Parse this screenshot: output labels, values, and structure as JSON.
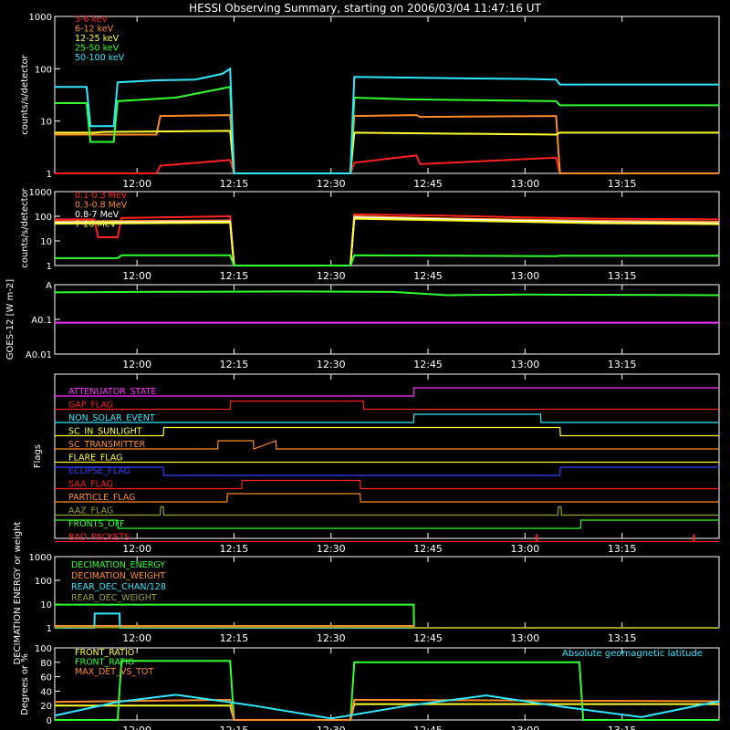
{
  "title": "HESSI Observing Summary, starting on 2006/03/04 11:47:16 UT",
  "time_ticks": [
    "12:00",
    "12:15",
    "12:30",
    "12:45",
    "13:00",
    "13:15"
  ],
  "colors": {
    "red": "#ff2020",
    "orange": "#ff8c28",
    "yellow": "#ffff30",
    "green": "#30ff30",
    "cyan": "#30e8ff",
    "magenta": "#ff30ff",
    "blue": "#3040ff",
    "olive": "#9aa020",
    "white": "#ffffff"
  },
  "chart_data": [
    {
      "id": "lightcurve_low",
      "type": "line",
      "ylabel": "counts/s/detector",
      "yscale": "log",
      "ylim": [
        1,
        1000
      ],
      "yticks": [
        "1",
        "10",
        "100",
        "1000"
      ],
      "series": [
        {
          "name": "3-6 keV",
          "color": "red",
          "x": [
            11.788,
            12.05,
            12.06,
            12.24,
            12.25,
            12.55,
            12.56,
            12.72,
            12.73,
            13.08,
            13.09,
            13.5
          ],
          "y": [
            1,
            1,
            1.4,
            1.8,
            1,
            1,
            1.6,
            2.2,
            1.5,
            2.0,
            1,
            1
          ]
        },
        {
          "name": "6-12 keV",
          "color": "orange",
          "x": [
            11.788,
            12.05,
            12.06,
            12.24,
            12.25,
            12.55,
            12.56,
            12.72,
            12.73,
            13.08,
            13.09,
            13.5
          ],
          "y": [
            5.5,
            5.5,
            12.5,
            13,
            1,
            1,
            12.5,
            13,
            12,
            12.5,
            1,
            1
          ]
        },
        {
          "name": "12-25 keV",
          "color": "yellow",
          "x": [
            11.788,
            11.89,
            11.91,
            12.24,
            12.25,
            12.55,
            12.56,
            13.08,
            13.09,
            13.5
          ],
          "y": [
            6,
            6,
            6.2,
            6.5,
            1,
            1,
            6,
            5.5,
            6,
            6
          ]
        },
        {
          "name": "25-50 keV",
          "color": "green",
          "x": [
            11.788,
            11.87,
            11.88,
            11.94,
            11.95,
            12.1,
            12.24,
            12.25,
            12.55,
            12.56,
            12.7,
            12.9,
            13.08,
            13.09,
            13.5
          ],
          "y": [
            22,
            22,
            4,
            4,
            24,
            28,
            45,
            1,
            1,
            28,
            26,
            25,
            24,
            20,
            20
          ]
        },
        {
          "name": "50-100 keV",
          "color": "cyan",
          "x": [
            11.788,
            11.87,
            11.88,
            11.94,
            11.95,
            12.05,
            12.15,
            12.22,
            12.24,
            12.25,
            12.55,
            12.56,
            12.8,
            13.0,
            13.08,
            13.09,
            13.5
          ],
          "y": [
            45,
            45,
            8,
            8,
            55,
            60,
            62,
            80,
            100,
            1,
            1,
            70,
            66,
            64,
            62,
            50,
            50
          ]
        }
      ]
    },
    {
      "id": "lightcurve_high",
      "type": "line",
      "ylabel": "counts/s/detector",
      "yscale": "log",
      "ylim": [
        1,
        1000
      ],
      "yticks": [
        "1",
        "10",
        "100",
        "1000"
      ],
      "series": [
        {
          "name": "0.1-0.3 MeV",
          "color": "red",
          "x": [
            11.788,
            11.89,
            11.9,
            11.95,
            11.96,
            12.24,
            12.25,
            12.55,
            12.56,
            12.8,
            13.0,
            13.2,
            13.5
          ],
          "y": [
            75,
            75,
            14,
            14,
            85,
            100,
            1,
            1,
            120,
            105,
            90,
            80,
            75
          ]
        },
        {
          "name": "0.3-0.8 MeV",
          "color": "orange",
          "x": [
            11.788,
            12.24,
            12.25,
            12.55,
            12.56,
            12.8,
            13.2,
            13.5
          ],
          "y": [
            62,
            68,
            1,
            1,
            100,
            82,
            65,
            60
          ]
        },
        {
          "name": "0.8-7 MeV",
          "color": "white",
          "x": [
            11.788,
            12.24,
            12.25,
            12.55,
            12.56,
            12.8,
            13.2,
            13.5
          ],
          "y": [
            55,
            60,
            1,
            1,
            90,
            75,
            58,
            52
          ]
        },
        {
          "name": "7-20 MeV",
          "color": "yellow",
          "x": [
            11.788,
            12.24,
            12.25,
            12.55,
            12.56,
            12.8,
            13.2,
            13.5
          ],
          "y": [
            50,
            55,
            1,
            1,
            80,
            68,
            52,
            48
          ]
        },
        {
          "name": "",
          "color": "green",
          "x": [
            11.788,
            11.95,
            11.96,
            12.24,
            12.25,
            12.55,
            12.56,
            13.08,
            13.09,
            13.5
          ],
          "y": [
            2,
            2,
            2.6,
            2.6,
            1,
            1,
            2.6,
            2.4,
            2.5,
            2.5
          ]
        }
      ]
    },
    {
      "id": "goes",
      "type": "line",
      "ylabel": "GOES-12 [W m-2]",
      "yscale": "log",
      "ylim": [
        0.01,
        1
      ],
      "yticks": [
        "A0.01",
        "A0.1",
        "A"
      ],
      "series": [
        {
          "name": "",
          "color": "green",
          "x": [
            11.788,
            12.0,
            12.4,
            12.66,
            12.8,
            13.0,
            13.5
          ],
          "y": [
            0.6,
            0.62,
            0.64,
            0.62,
            0.5,
            0.52,
            0.5
          ]
        },
        {
          "name": "",
          "color": "magenta",
          "x": [
            11.788,
            13.5
          ],
          "y": [
            0.08,
            0.08
          ]
        }
      ]
    },
    {
      "id": "flags",
      "type": "line",
      "ylabel": "Flags",
      "series": [
        {
          "name": "ATTENUATOR_STATE",
          "color": "magenta",
          "x": [
            11.788,
            12.713,
            12.714,
            13.5
          ],
          "y": [
            0,
            0,
            1,
            1
          ]
        },
        {
          "name": "GAP_FLAG",
          "color": "red",
          "x": [
            11.788,
            12.24,
            12.241,
            12.583,
            12.584,
            13.5
          ],
          "y": [
            0,
            0,
            1,
            1,
            0,
            0
          ]
        },
        {
          "name": "NON_SOLAR_EVENT",
          "color": "cyan",
          "x": [
            11.788,
            12.713,
            12.714,
            13.04,
            13.041,
            13.5
          ],
          "y": [
            0,
            0,
            1,
            1,
            0,
            0
          ]
        },
        {
          "name": "SC_IN_SUNLIGHT",
          "color": "yellow",
          "x": [
            11.788,
            12.068,
            12.069,
            13.09,
            13.091,
            13.5
          ],
          "y": [
            0,
            0,
            1,
            1,
            0,
            0
          ]
        },
        {
          "name": "SC_TRANSMITTER",
          "color": "orange",
          "x": [
            11.788,
            12.208,
            12.209,
            12.3,
            12.301,
            12.358,
            12.359,
            13.5
          ],
          "y": [
            0,
            0,
            1,
            1,
            0,
            1,
            0,
            0
          ]
        },
        {
          "name": "FLARE_FLAG",
          "color": "yellow",
          "x": [
            11.788,
            13.5
          ],
          "y": [
            0,
            0
          ]
        },
        {
          "name": "ECLIPSE_FLAG",
          "color": "blue",
          "x": [
            11.788,
            12.068,
            12.069,
            13.09,
            13.091,
            13.5
          ],
          "y": [
            1,
            1,
            0,
            0,
            1,
            1
          ]
        },
        {
          "name": "SAA_FLAG",
          "color": "red",
          "x": [
            11.788,
            12.27,
            12.271,
            12.575,
            12.576,
            13.5
          ],
          "y": [
            0,
            0,
            1,
            1,
            0,
            0
          ]
        },
        {
          "name": "PARTICLE_FLAG",
          "color": "orange",
          "x": [
            11.788,
            12.232,
            12.233,
            12.575,
            12.576,
            13.5
          ],
          "y": [
            0,
            0,
            1,
            1,
            0,
            0
          ]
        },
        {
          "name": "AAZ_FLAG",
          "color": "olive",
          "x": [
            11.788,
            12.06,
            12.061,
            12.068,
            12.069,
            13.085,
            13.086,
            13.093,
            13.094,
            13.5
          ],
          "y": [
            0,
            0,
            1,
            1,
            0,
            0,
            1,
            1,
            0,
            0
          ]
        },
        {
          "name": "FRONTS_OFF",
          "color": "green",
          "x": [
            11.788,
            11.95,
            11.951,
            13.143,
            13.144,
            13.5
          ],
          "y": [
            1,
            1,
            0,
            0,
            1,
            1
          ]
        },
        {
          "name": "BAD_PACKETS",
          "color": "red",
          "x": [
            11.788,
            13.5
          ],
          "y": [
            0,
            0
          ],
          "spikes": [
            13.03,
            13.435
          ]
        }
      ]
    },
    {
      "id": "decimation",
      "type": "line",
      "ylabel": "DECIMATION ENERGY or weight",
      "yscale": "log",
      "ylim": [
        1,
        1000
      ],
      "yticks": [
        "1",
        "10",
        "100",
        "1000"
      ],
      "series": [
        {
          "name": "DECIMATION_ENERGY",
          "color": "green",
          "x": [
            11.788,
            12.713,
            12.714,
            13.5
          ],
          "y": [
            9.5,
            9.5,
            1,
            1
          ]
        },
        {
          "name": "DECIMATION_WEIGHT",
          "color": "orange",
          "x": [
            11.788,
            12.713,
            12.714,
            13.5
          ],
          "y": [
            1.2,
            1.2,
            1,
            1
          ]
        },
        {
          "name": "REAR_DEC_CHAN/128",
          "color": "cyan",
          "x": [
            11.788,
            11.89,
            11.891,
            11.955,
            11.956,
            13.5
          ],
          "y": [
            1,
            1,
            4,
            4,
            1,
            1
          ]
        },
        {
          "name": "REAR_DEC_WEIGHT",
          "color": "olive",
          "x": [
            11.788,
            12.713,
            12.714,
            13.5
          ],
          "y": [
            1.05,
            1.05,
            1,
            1
          ]
        }
      ]
    },
    {
      "id": "ratios",
      "type": "line",
      "ylabel": "Degrees or %",
      "ylim": [
        0,
        100
      ],
      "yticks": [
        "0",
        "20",
        "40",
        "60",
        "80",
        "100"
      ],
      "series": [
        {
          "name": "FRONT_RATIO",
          "color": "yellow",
          "x": [
            11.788,
            12.24,
            12.25,
            12.55,
            12.56,
            13.5
          ],
          "y": [
            20,
            20,
            0,
            0,
            22,
            22
          ]
        },
        {
          "name": "FRONT_RATIO",
          "color": "green",
          "x": [
            11.788,
            11.95,
            11.96,
            12.24,
            12.25,
            12.55,
            12.56,
            13.14,
            13.15,
            13.5
          ],
          "y": [
            0,
            0,
            82,
            82,
            0,
            0,
            80,
            80,
            0,
            0
          ]
        },
        {
          "name": "MAX_DET_VS_TOT",
          "color": "orange",
          "x": [
            11.788,
            12.24,
            12.25,
            12.55,
            12.56,
            13.5
          ],
          "y": [
            25,
            28,
            0,
            0,
            28,
            26
          ]
        },
        {
          "name": "Absolute geomagnetic latitude",
          "color": "cyan",
          "x": [
            11.788,
            11.95,
            12.1,
            12.3,
            12.5,
            12.7,
            12.9,
            13.1,
            13.3,
            13.5
          ],
          "y": [
            6,
            25,
            35,
            20,
            2,
            20,
            34,
            18,
            4,
            26
          ]
        }
      ]
    }
  ]
}
